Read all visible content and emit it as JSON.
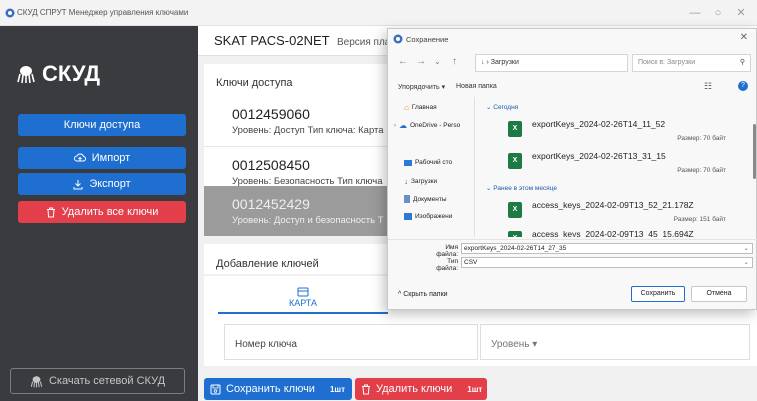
{
  "window": {
    "title": "СКУД СПРУТ Менеджер управления ключами",
    "minimize": "—",
    "maximize": "○",
    "close": "✕"
  },
  "sidebar": {
    "logo_text": "СКУД",
    "keys_button": "Ключи доступа",
    "import_button": "Импорт",
    "export_button": "Экспорт",
    "delete_all_button": "Удалить все ключи",
    "download_button": "Скачать сетевой СКУД"
  },
  "header": {
    "device": "SKAT PACS-02NET",
    "version_label": "Версия платы"
  },
  "keys_section": {
    "title": "Ключи доступа",
    "items": [
      {
        "number": "0012459060",
        "meta": "Уровень: Доступ   Тип ключа: Карта"
      },
      {
        "number": "0012508450",
        "meta": "Уровень: Безопасность   Тип ключа"
      },
      {
        "number": "0012452429",
        "meta": "Уровень: Доступ и безопасность   Т"
      }
    ]
  },
  "add_section": {
    "title": "Добавление ключей",
    "tab_label": "КАРТА",
    "key_number_placeholder": "Номер ключа",
    "level_placeholder": "Уровень ▾"
  },
  "bottom_actions": {
    "save_label": "Сохранить ключи",
    "save_count": "1шт",
    "delete_label": "Удалить ключи",
    "delete_count": "1шт"
  },
  "save_dialog": {
    "title": "Сохранение",
    "close": "✕",
    "path": "› Загрузки",
    "search_placeholder": "Поиск в: Загрузки",
    "organize": "Упорядочить ▾",
    "new_folder": "Новая папка",
    "nav": [
      {
        "label": "Главная",
        "icon": "home-icon"
      },
      {
        "label": "OneDrive - Perso",
        "icon": "cloud-icon"
      },
      {
        "label": "Рабочий сто",
        "icon": "desktop-icon"
      },
      {
        "label": "Загрузки",
        "icon": "download-icon"
      },
      {
        "label": "Документы",
        "icon": "document-icon"
      },
      {
        "label": "Изображени",
        "icon": "image-icon"
      }
    ],
    "group_today": "Сегодня",
    "group_earlier": "Ранее в этом месяце",
    "files": [
      {
        "name": "exportKeys_2024-02-26T14_11_52",
        "size": "Размер: 70 байт"
      },
      {
        "name": "exportKeys_2024-02-26T13_31_15",
        "size": "Размер: 70 байт"
      },
      {
        "name": "access_keys_2024-02-09T13_52_21.178Z",
        "size": "Размер: 151 байт"
      },
      {
        "name": "access_keys_2024-02-09T13_45_15.694Z",
        "size": ""
      }
    ],
    "filename_label": "Имя файла:",
    "filename_value": "exportKeys_2024-02-26T14_27_35",
    "filetype_label": "Тип файла:",
    "filetype_value": "CSV",
    "hide_folders": "Скрыть папки",
    "save_button": "Сохранить",
    "cancel_button": "Отмена"
  }
}
